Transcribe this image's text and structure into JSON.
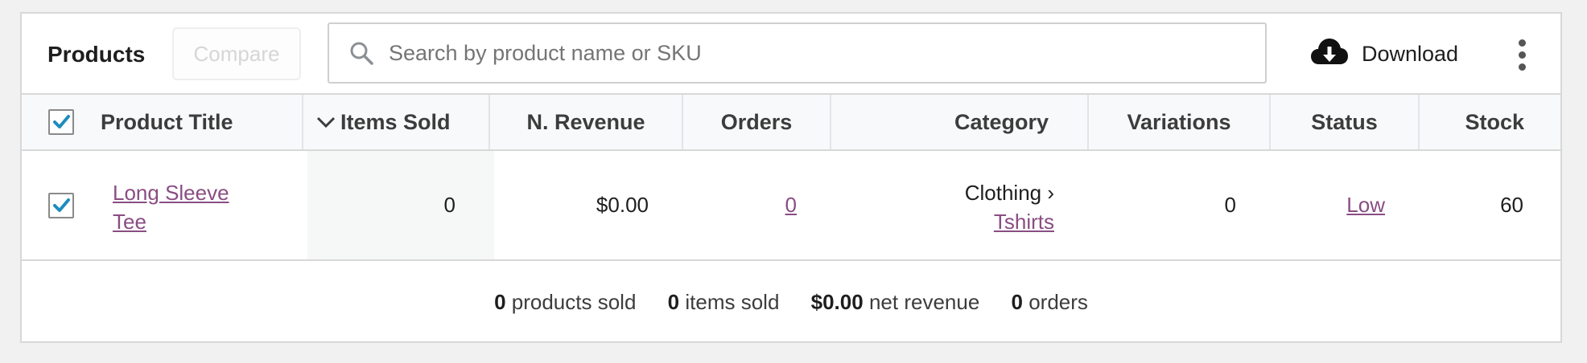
{
  "header": {
    "title": "Products",
    "compare_label": "Compare",
    "search_placeholder": "Search by product name or SKU",
    "download_label": "Download"
  },
  "columns": [
    {
      "label": "Product Title"
    },
    {
      "label": "Items Sold",
      "sorted": "descending"
    },
    {
      "label": "N. Revenue"
    },
    {
      "label": "Orders"
    },
    {
      "label": "Category"
    },
    {
      "label": "Variations"
    },
    {
      "label": "Status"
    },
    {
      "label": "Stock"
    }
  ],
  "rows": [
    {
      "selected": true,
      "title_line1": "Long Sleeve",
      "title_line2": "Tee",
      "items_sold": "0",
      "net_revenue": "$0.00",
      "orders": "0",
      "category_parent": "Clothing ›",
      "category_child": "Tshirts",
      "variations": "0",
      "status": "Low",
      "stock": "60"
    }
  ],
  "summary": {
    "products_sold_value": "0",
    "products_sold_label": "products sold",
    "items_sold_value": "0",
    "items_sold_label": "items sold",
    "net_revenue_value": "$0.00",
    "net_revenue_label": "net revenue",
    "orders_value": "0",
    "orders_label": "orders"
  },
  "colors": {
    "link": "#8a4d83",
    "checkbox_check": "#1e8cbe",
    "disabled_text": "#d6d6d6"
  },
  "icons": {
    "search": "search-icon",
    "download": "cloud-download-icon",
    "more": "vertical-ellipsis-icon",
    "sort": "chevron-down-icon"
  }
}
